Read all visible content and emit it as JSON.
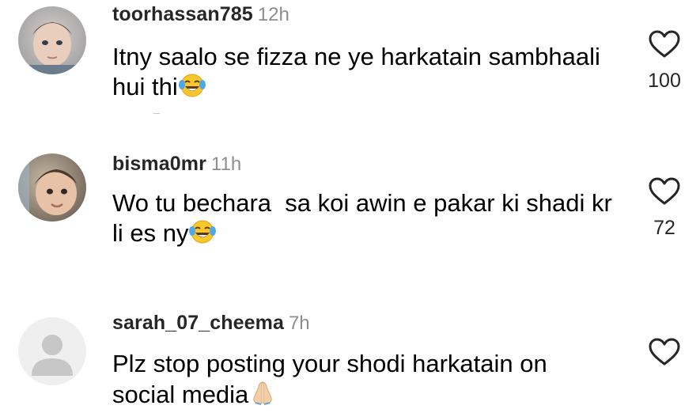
{
  "comments": [
    {
      "username": "toorhassan785",
      "time": "12h",
      "text": "Itny saalo se fizza ne ye harkatain sambhaali hui thi",
      "emoji": "face-with-tears-of-joy",
      "likes": "100",
      "avatar": "child-photo-avatar"
    },
    {
      "username": "bisma0mr",
      "time": "11h",
      "text": "Wo tu bechara  sa koi awin e pakar ki shadi kr li es ny",
      "emoji": "face-with-tears-of-joy",
      "likes": "72",
      "avatar": "toddler-photo-avatar"
    },
    {
      "username": "sarah_07_cheema",
      "time": "7h",
      "text": "Plz stop posting your shodi harkatain on social media",
      "emoji": "folded-hands",
      "likes": "",
      "avatar": "default-user-avatar"
    }
  ],
  "icons": {
    "like": "heart-outline-icon"
  },
  "colors": {
    "username": "#262626",
    "timestamp": "#8e8e8e",
    "heart_stroke": "#262626",
    "default_avatar_bg": "#efefef",
    "default_avatar_fg": "#c7c7c7"
  }
}
